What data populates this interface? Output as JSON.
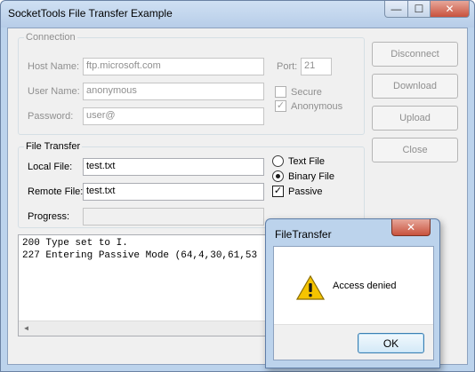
{
  "window": {
    "title": "SocketTools File Transfer Example",
    "minimize_glyph": "—",
    "maximize_glyph": "☐",
    "close_glyph": "✕"
  },
  "connection": {
    "group_label": "Connection",
    "host_label": "Host Name:",
    "host_value": "ftp.microsoft.com",
    "port_label": "Port:",
    "port_value": "21",
    "user_label": "User Name:",
    "user_value": "anonymous",
    "password_label": "Password:",
    "password_value": "user@",
    "secure_label": "Secure",
    "secure_checked": false,
    "anonymous_label": "Anonymous",
    "anonymous_checked": true
  },
  "file_transfer": {
    "group_label": "File Transfer",
    "local_label": "Local File:",
    "local_value": "test.txt",
    "remote_label": "Remote File:",
    "remote_value": "test.txt",
    "progress_label": "Progress:",
    "progress_fraction": 0,
    "text_file_label": "Text File",
    "binary_file_label": "Binary File",
    "selected_mode": "Binary File",
    "passive_label": "Passive",
    "passive_checked": true
  },
  "buttons": {
    "disconnect": "Disconnect",
    "download": "Download",
    "upload": "Upload",
    "close": "Close"
  },
  "log": {
    "lines": [
      "200 Type set to I.",
      "227 Entering Passive Mode (64,4,30,61,53"
    ]
  },
  "dialog": {
    "title": "FileTransfer",
    "message": "Access denied",
    "ok_label": "OK",
    "icon": "warning-icon",
    "close_glyph": "✕"
  },
  "colors": {
    "frame": "#bcd3ec",
    "client": "#f0f0f0",
    "disabled_text": "#8f8f8f",
    "warning_yellow": "#f5c400"
  }
}
